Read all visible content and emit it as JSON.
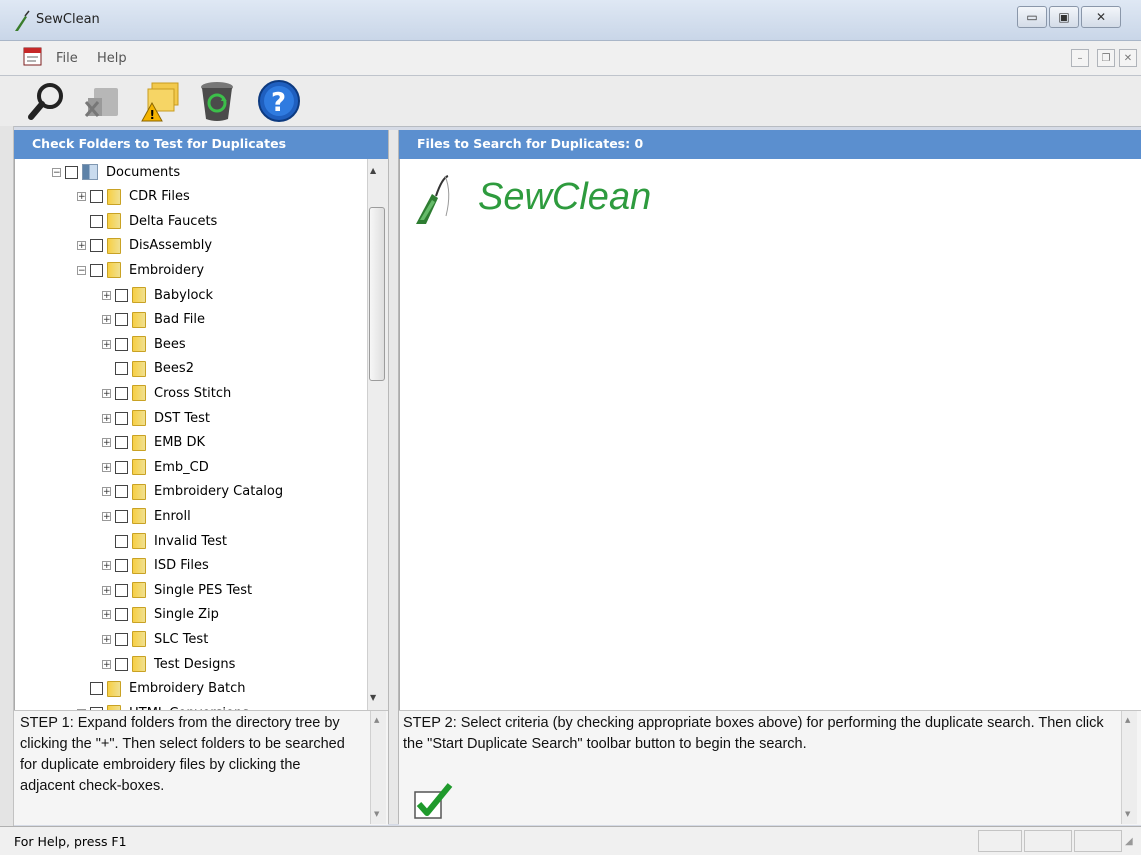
{
  "window": {
    "title": "SewClean"
  },
  "menu": {
    "file": "File",
    "help": "Help"
  },
  "left_pane": {
    "header": "Check Folders to Test for Duplicates",
    "tree": [
      {
        "label": "Documents",
        "level": 0,
        "expander": "minus",
        "icon": "document-library-icon"
      },
      {
        "label": "CDR Files",
        "level": 1,
        "expander": "plus",
        "icon": "folder-icon"
      },
      {
        "label": "Delta Faucets",
        "level": 1,
        "expander": "none",
        "icon": "folder-icon"
      },
      {
        "label": "DisAssembly",
        "level": 1,
        "expander": "plus",
        "icon": "folder-icon"
      },
      {
        "label": "Embroidery",
        "level": 1,
        "expander": "minus",
        "icon": "folder-icon"
      },
      {
        "label": "Babylock",
        "level": 2,
        "expander": "plus",
        "icon": "folder-icon"
      },
      {
        "label": "Bad File",
        "level": 2,
        "expander": "plus",
        "icon": "folder-icon"
      },
      {
        "label": "Bees",
        "level": 2,
        "expander": "plus",
        "icon": "folder-icon"
      },
      {
        "label": "Bees2",
        "level": 2,
        "expander": "none",
        "icon": "folder-icon"
      },
      {
        "label": "Cross Stitch",
        "level": 2,
        "expander": "plus",
        "icon": "folder-icon"
      },
      {
        "label": "DST Test",
        "level": 2,
        "expander": "plus",
        "icon": "folder-icon"
      },
      {
        "label": "EMB DK",
        "level": 2,
        "expander": "plus",
        "icon": "folder-icon"
      },
      {
        "label": "Emb_CD",
        "level": 2,
        "expander": "plus",
        "icon": "folder-icon"
      },
      {
        "label": "Embroidery Catalog",
        "level": 2,
        "expander": "plus",
        "icon": "folder-icon"
      },
      {
        "label": "Enroll",
        "level": 2,
        "expander": "plus",
        "icon": "folder-icon"
      },
      {
        "label": "Invalid Test",
        "level": 2,
        "expander": "none",
        "icon": "folder-icon"
      },
      {
        "label": "ISD Files",
        "level": 2,
        "expander": "plus",
        "icon": "folder-icon"
      },
      {
        "label": "Single PES Test",
        "level": 2,
        "expander": "plus",
        "icon": "folder-icon"
      },
      {
        "label": "Single Zip",
        "level": 2,
        "expander": "plus",
        "icon": "folder-icon"
      },
      {
        "label": "SLC Test",
        "level": 2,
        "expander": "plus",
        "icon": "folder-icon"
      },
      {
        "label": "Test Designs",
        "level": 2,
        "expander": "plus",
        "icon": "folder-icon"
      },
      {
        "label": "Embroidery Batch",
        "level": 1,
        "expander": "none",
        "icon": "folder-icon"
      },
      {
        "label": "HTML Conversions",
        "level": 1,
        "expander": "plus",
        "icon": "folder-icon"
      }
    ],
    "step_text": "STEP 1: Expand folders from the directory tree by clicking the \"+\". Then select folders to be searched for duplicate embroidery files by clicking the adjacent check-boxes."
  },
  "right_pane": {
    "header": "Files to Search for Duplicates: 0",
    "logo_text": "SewClean",
    "step_text": "STEP 2: Select criteria (by checking appropriate boxes above) for performing the duplicate search. Then click the \"Start Duplicate Search\" toolbar button to begin the search."
  },
  "toolbar": {
    "icons": [
      "search-icon",
      "clear-icon",
      "folder-warning-icon",
      "recycle-bin-icon",
      "help-icon"
    ]
  },
  "statusbar": {
    "text": "For Help, press F1"
  },
  "colors": {
    "pane_header": "#5b8fcf",
    "logo_green": "#2e9b3e"
  }
}
